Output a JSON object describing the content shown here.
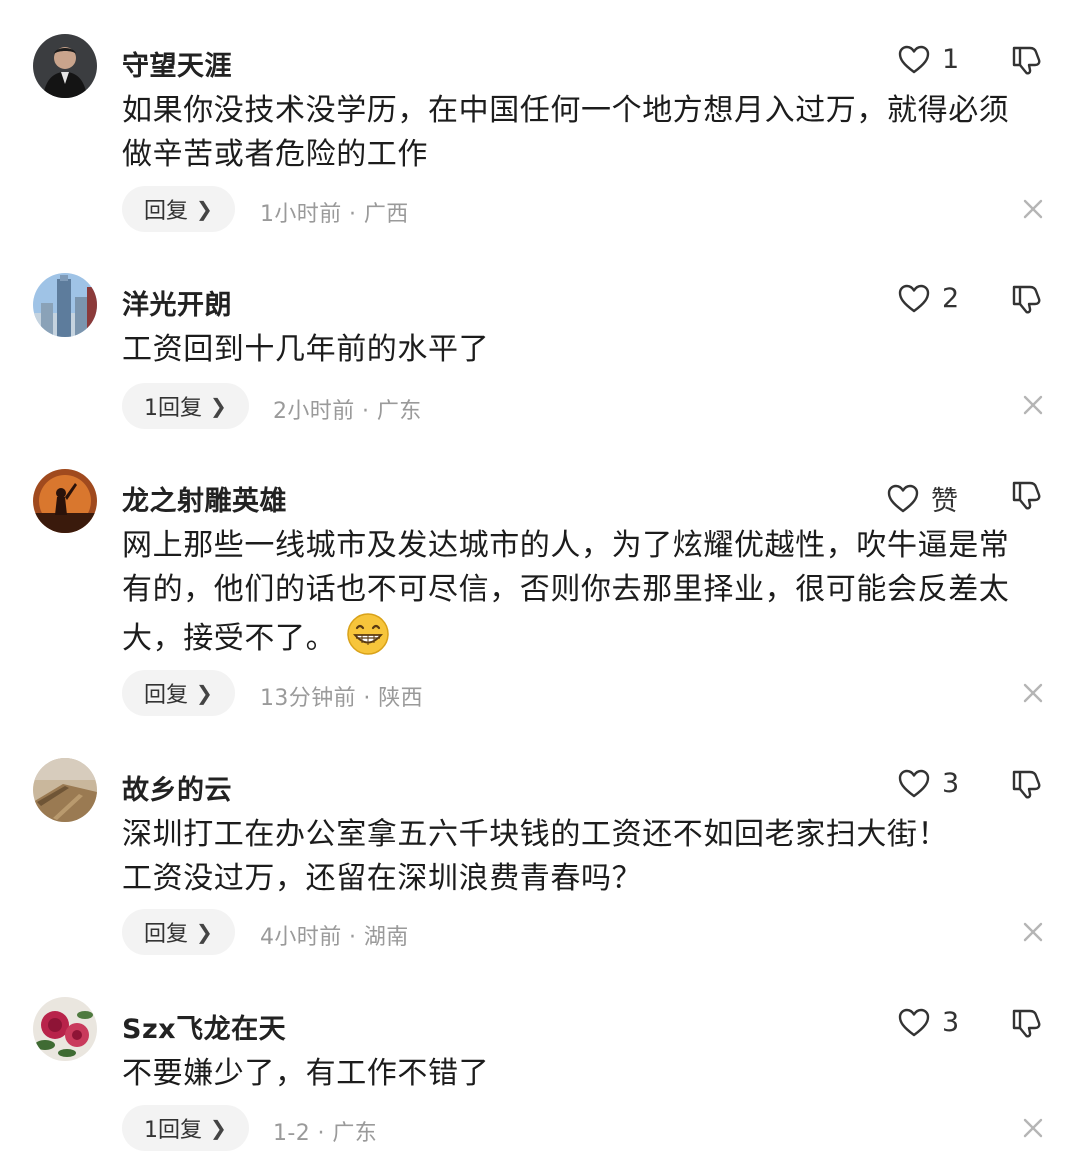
{
  "comments": [
    {
      "username": "守望天涯",
      "like_count": "1",
      "content": "如果你没技术没学历，在中国任何一个地方想月入过万，就得必须做辛苦或者危险的工作",
      "reply_label": "回复",
      "time": "1小时前",
      "sep": "·",
      "location": "广西"
    },
    {
      "username": "洋光开朗",
      "like_count": "2",
      "content": "工资回到十几年前的水平了",
      "reply_label": "1回复",
      "time": "2小时前",
      "sep": "·",
      "location": "广东"
    },
    {
      "username": "龙之射雕英雄",
      "like_count": "赞",
      "content": "网上那些一线城市及发达城市的人，为了炫耀优越性，吹牛逼是常有的，他们的话也不可尽信，否则你去那里择业，很可能会反差太大，接受不了。",
      "reply_label": "回复",
      "time": "13分钟前",
      "sep": "·",
      "location": "陕西"
    },
    {
      "username": "故乡的云",
      "like_count": "3",
      "content_line1": "深圳打工在办公室拿五六千块钱的工资还不如回老家扫大街！",
      "content_line2": "工资没过万，还留在深圳浪费青春吗？",
      "reply_label": "回复",
      "time": "4小时前",
      "sep": "·",
      "location": "湖南"
    },
    {
      "username": "Szx飞龙在天",
      "like_count": "3",
      "content": "不要嫌少了，有工作不错了",
      "reply_label": "1回复",
      "time": "1-2",
      "sep": "·",
      "location": "广东"
    }
  ],
  "icons": {
    "like": "heart-outline-icon",
    "dislike": "thumbs-down-icon",
    "close": "close-x-icon",
    "emoji": "grinning-emoji-icon",
    "chevron": "chevron-right-icon"
  },
  "colors": {
    "meta_text": "#9a9a9a",
    "reply_bg": "#f3f3f3"
  }
}
